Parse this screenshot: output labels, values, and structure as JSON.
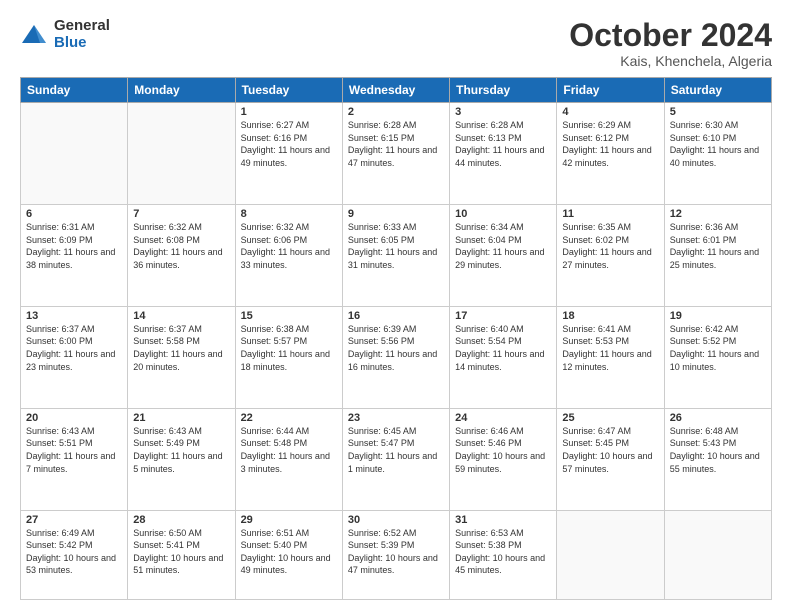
{
  "logo": {
    "general": "General",
    "blue": "Blue"
  },
  "title": "October 2024",
  "location": "Kais, Khenchela, Algeria",
  "weekdays": [
    "Sunday",
    "Monday",
    "Tuesday",
    "Wednesday",
    "Thursday",
    "Friday",
    "Saturday"
  ],
  "weeks": [
    [
      {
        "day": "",
        "info": ""
      },
      {
        "day": "",
        "info": ""
      },
      {
        "day": "1",
        "info": "Sunrise: 6:27 AM\nSunset: 6:16 PM\nDaylight: 11 hours and 49 minutes."
      },
      {
        "day": "2",
        "info": "Sunrise: 6:28 AM\nSunset: 6:15 PM\nDaylight: 11 hours and 47 minutes."
      },
      {
        "day": "3",
        "info": "Sunrise: 6:28 AM\nSunset: 6:13 PM\nDaylight: 11 hours and 44 minutes."
      },
      {
        "day": "4",
        "info": "Sunrise: 6:29 AM\nSunset: 6:12 PM\nDaylight: 11 hours and 42 minutes."
      },
      {
        "day": "5",
        "info": "Sunrise: 6:30 AM\nSunset: 6:10 PM\nDaylight: 11 hours and 40 minutes."
      }
    ],
    [
      {
        "day": "6",
        "info": "Sunrise: 6:31 AM\nSunset: 6:09 PM\nDaylight: 11 hours and 38 minutes."
      },
      {
        "day": "7",
        "info": "Sunrise: 6:32 AM\nSunset: 6:08 PM\nDaylight: 11 hours and 36 minutes."
      },
      {
        "day": "8",
        "info": "Sunrise: 6:32 AM\nSunset: 6:06 PM\nDaylight: 11 hours and 33 minutes."
      },
      {
        "day": "9",
        "info": "Sunrise: 6:33 AM\nSunset: 6:05 PM\nDaylight: 11 hours and 31 minutes."
      },
      {
        "day": "10",
        "info": "Sunrise: 6:34 AM\nSunset: 6:04 PM\nDaylight: 11 hours and 29 minutes."
      },
      {
        "day": "11",
        "info": "Sunrise: 6:35 AM\nSunset: 6:02 PM\nDaylight: 11 hours and 27 minutes."
      },
      {
        "day": "12",
        "info": "Sunrise: 6:36 AM\nSunset: 6:01 PM\nDaylight: 11 hours and 25 minutes."
      }
    ],
    [
      {
        "day": "13",
        "info": "Sunrise: 6:37 AM\nSunset: 6:00 PM\nDaylight: 11 hours and 23 minutes."
      },
      {
        "day": "14",
        "info": "Sunrise: 6:37 AM\nSunset: 5:58 PM\nDaylight: 11 hours and 20 minutes."
      },
      {
        "day": "15",
        "info": "Sunrise: 6:38 AM\nSunset: 5:57 PM\nDaylight: 11 hours and 18 minutes."
      },
      {
        "day": "16",
        "info": "Sunrise: 6:39 AM\nSunset: 5:56 PM\nDaylight: 11 hours and 16 minutes."
      },
      {
        "day": "17",
        "info": "Sunrise: 6:40 AM\nSunset: 5:54 PM\nDaylight: 11 hours and 14 minutes."
      },
      {
        "day": "18",
        "info": "Sunrise: 6:41 AM\nSunset: 5:53 PM\nDaylight: 11 hours and 12 minutes."
      },
      {
        "day": "19",
        "info": "Sunrise: 6:42 AM\nSunset: 5:52 PM\nDaylight: 11 hours and 10 minutes."
      }
    ],
    [
      {
        "day": "20",
        "info": "Sunrise: 6:43 AM\nSunset: 5:51 PM\nDaylight: 11 hours and 7 minutes."
      },
      {
        "day": "21",
        "info": "Sunrise: 6:43 AM\nSunset: 5:49 PM\nDaylight: 11 hours and 5 minutes."
      },
      {
        "day": "22",
        "info": "Sunrise: 6:44 AM\nSunset: 5:48 PM\nDaylight: 11 hours and 3 minutes."
      },
      {
        "day": "23",
        "info": "Sunrise: 6:45 AM\nSunset: 5:47 PM\nDaylight: 11 hours and 1 minute."
      },
      {
        "day": "24",
        "info": "Sunrise: 6:46 AM\nSunset: 5:46 PM\nDaylight: 10 hours and 59 minutes."
      },
      {
        "day": "25",
        "info": "Sunrise: 6:47 AM\nSunset: 5:45 PM\nDaylight: 10 hours and 57 minutes."
      },
      {
        "day": "26",
        "info": "Sunrise: 6:48 AM\nSunset: 5:43 PM\nDaylight: 10 hours and 55 minutes."
      }
    ],
    [
      {
        "day": "27",
        "info": "Sunrise: 6:49 AM\nSunset: 5:42 PM\nDaylight: 10 hours and 53 minutes."
      },
      {
        "day": "28",
        "info": "Sunrise: 6:50 AM\nSunset: 5:41 PM\nDaylight: 10 hours and 51 minutes."
      },
      {
        "day": "29",
        "info": "Sunrise: 6:51 AM\nSunset: 5:40 PM\nDaylight: 10 hours and 49 minutes."
      },
      {
        "day": "30",
        "info": "Sunrise: 6:52 AM\nSunset: 5:39 PM\nDaylight: 10 hours and 47 minutes."
      },
      {
        "day": "31",
        "info": "Sunrise: 6:53 AM\nSunset: 5:38 PM\nDaylight: 10 hours and 45 minutes."
      },
      {
        "day": "",
        "info": ""
      },
      {
        "day": "",
        "info": ""
      }
    ]
  ]
}
